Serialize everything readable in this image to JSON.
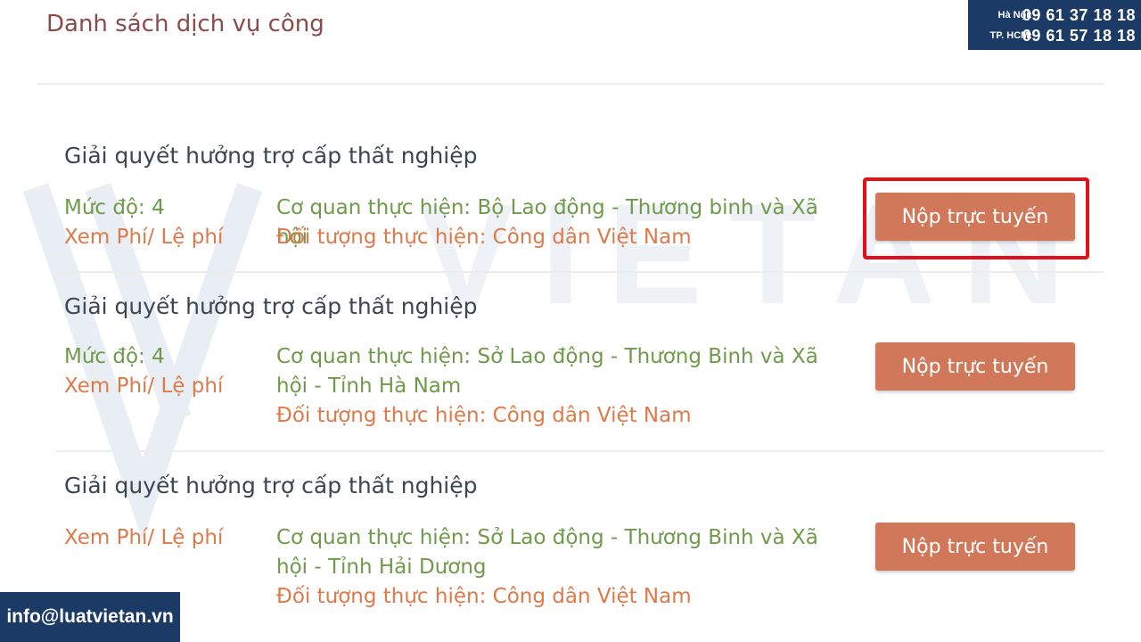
{
  "page": {
    "title": "Danh sách dịch vụ công"
  },
  "contact": {
    "hanoi_label": "Hà Nội:",
    "hanoi_phone": "09 61 37 18 18",
    "hcm_label": "TP. HCM:",
    "hcm_phone": "09 61 57 18 18",
    "email": "info@luatvietan.vn"
  },
  "watermark": {
    "text": "VIETAN LAW"
  },
  "services": [
    {
      "title": "Giải quyết hưởng trợ cấp thất nghiệp",
      "level": "Mức độ: 4",
      "fee_link": "Xem Phí/ Lệ phí",
      "agency": "Cơ quan thực hiện: Bộ Lao động - Thương binh và Xã hội",
      "subject": "Đối tượng thực hiện: Công dân Việt Nam",
      "button": "Nộp trực tuyến"
    },
    {
      "title": "Giải quyết hưởng trợ cấp thất nghiệp",
      "level": "Mức độ: 4",
      "fee_link": "Xem Phí/ Lệ phí",
      "agency": "Cơ quan thực hiện: Sở Lao động - Thương Binh và Xã hội - Tỉnh Hà Nam",
      "subject": "Đối tượng thực hiện: Công dân Việt Nam",
      "button": "Nộp trực tuyến"
    },
    {
      "title": "Giải quyết hưởng trợ cấp thất nghiệp",
      "fee_link": "Xem Phí/ Lệ phí",
      "agency": "Cơ quan thực hiện: Sở Lao động - Thương Binh và Xã hội - Tỉnh Hải Dương",
      "subject": "Đối tượng thực hiện: Công dân Việt Nam",
      "button": "Nộp trực tuyến"
    }
  ],
  "colors": {
    "title": "#8c4a4a",
    "level_text": "#6f9a4a",
    "link_text": "#de7a4a",
    "button_bg": "#d2785a",
    "highlight_border": "#e3101b",
    "contact_bg": "#1c3a66"
  }
}
